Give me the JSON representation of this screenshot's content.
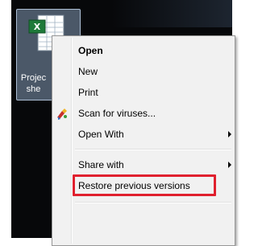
{
  "desktop": {
    "file": {
      "name_line1": "Projec",
      "name_line2": "she",
      "icon": "excel-spreadsheet-icon"
    }
  },
  "context_menu": {
    "items": [
      {
        "label": "Open",
        "bold": true
      },
      {
        "label": "New"
      },
      {
        "label": "Print"
      },
      {
        "label": "Scan for viruses...",
        "icon": "antivirus-icon"
      },
      {
        "label": "Open With",
        "submenu": true
      },
      {
        "label": "Share with",
        "submenu": true
      },
      {
        "label": "Restore previous versions",
        "highlighted": true
      }
    ]
  },
  "colors": {
    "desktop": "#07080a",
    "selection": "#aac8eb",
    "menu_bg": "#f1f1f1",
    "highlight_border": "#e0202e"
  }
}
